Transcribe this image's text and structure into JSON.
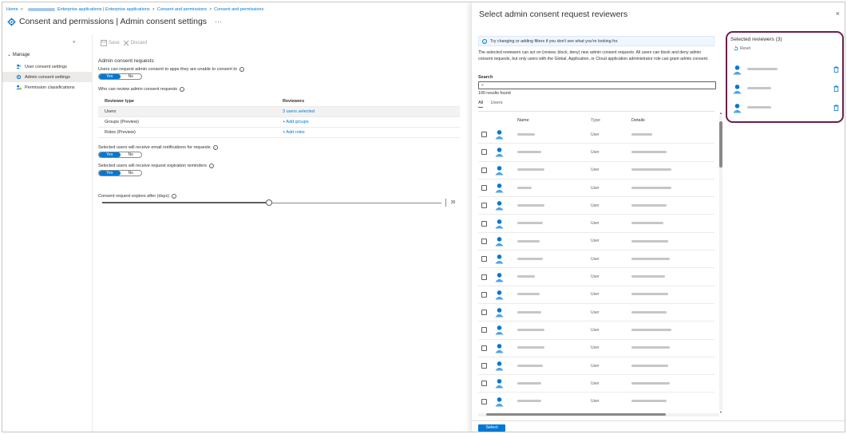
{
  "breadcrumb": {
    "home": "Home",
    "items": [
      "Enterprise applications | Enterprise applications",
      "Consent and permissions",
      "Consent and permissions"
    ]
  },
  "page": {
    "title_main": "Consent and permissions",
    "title_sub": "| Admin consent settings",
    "ellipsis": "···"
  },
  "sidebar": {
    "collapse": "«",
    "manage_label": "Manage",
    "items": [
      {
        "label": "User consent settings"
      },
      {
        "label": "Admin consent settings"
      },
      {
        "label": "Permission classifications"
      }
    ]
  },
  "toolbar": {
    "save": "Save",
    "discard": "Discard"
  },
  "content": {
    "section_title": "Admin consent requests",
    "q1": "Users can request admin consent to apps they are unable to consent to",
    "q2": "Who can review admin consent requests",
    "table_head": {
      "c1": "Reviewer type",
      "c2": "Reviewers"
    },
    "rows": [
      {
        "type": "Users",
        "value": "3 users selected"
      },
      {
        "type": "Groups (Preview)",
        "value": "+ Add groups"
      },
      {
        "type": "Roles (Preview)",
        "value": "+ Add roles"
      }
    ],
    "q3": "Selected users will receive email notifications for requests",
    "q4": "Selected users will receive request expiration reminders",
    "q5": "Consent request expires after (days)",
    "toggle_yes": "Yes",
    "toggle_no": "No",
    "slider_value": "30"
  },
  "panel": {
    "title": "Select admin consent request reviewers",
    "close": "×",
    "info": "Try changing or adding filters if you don't see what you're looking for.",
    "description": "The selected reviewers can act on (review, block, deny) new admin consent requests. All users can block and deny admin consent requests, but only users with the Global, Application, or Cloud application administrator role can grant admin consent.",
    "search_label": "Search",
    "search_icon": "⌕",
    "found": "100 results found",
    "tabs": [
      "All",
      "Users"
    ],
    "list_head": {
      "name": "Name",
      "type": "Type",
      "details": "Details"
    },
    "row_type": "User",
    "row_count": 16,
    "select_button": "Select"
  },
  "selected": {
    "title": "Selected reviewers (3)",
    "reset": "Reset"
  }
}
